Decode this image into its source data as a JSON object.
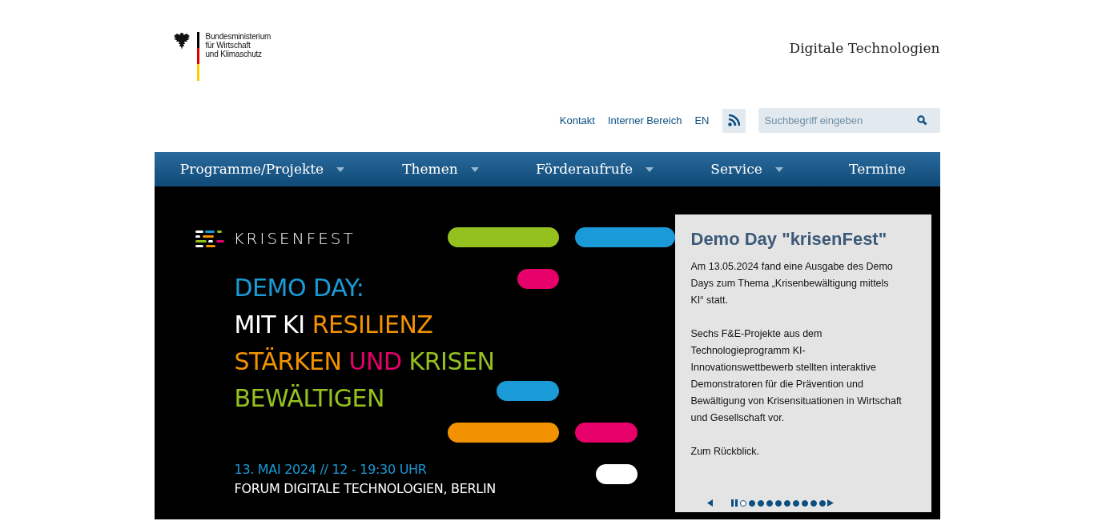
{
  "header": {
    "ministry_lines": [
      "Bundesministerium",
      "für Wirtschaft",
      "und Klimaschutz"
    ],
    "site_title": "Digitale Technologien"
  },
  "utility_links": [
    "Kontakt",
    "Interner Bereich",
    "EN"
  ],
  "search": {
    "placeholder": "Suchbegriff eingeben"
  },
  "nav": [
    {
      "label": "Programme/Projekte",
      "has_menu": true
    },
    {
      "label": "Themen",
      "has_menu": true
    },
    {
      "label": "Förderaufrufe",
      "has_menu": true
    },
    {
      "label": "Service",
      "has_menu": true
    },
    {
      "label": "Termine",
      "has_menu": false
    }
  ],
  "banner": {
    "brand": "KRISENFEST",
    "headline_lines": [
      [
        {
          "text": "DEMO DAY:",
          "color": "#1a9ad6"
        }
      ],
      [
        {
          "text": "MIT KI",
          "color": "#ffffff"
        },
        {
          "text": "RESILIENZ",
          "color": "#f39200"
        }
      ],
      [
        {
          "text": "STÄRKEN",
          "color": "#f39200"
        },
        {
          "text": "UND",
          "color": "#e5006a"
        },
        {
          "text": "KRISEN",
          "color": "#95c11f"
        }
      ],
      [
        {
          "text": "BEWÄLTIGEN",
          "color": "#95c11f"
        }
      ]
    ],
    "date": "13. MAI 2024 // 12 - 19:30 UHR",
    "venue": "FORUM DIGITALE TECHNOLOGIEN, BERLIN"
  },
  "teaser": {
    "title": "Demo Day \"krisenFest\"",
    "paragraphs": [
      "Am 13.05.2024 fand eine Ausgabe des Demo Days zum Thema „Krisenbewältigung mittels KI“ statt.",
      "Sechs F&E-Projekte aus dem Technologieprogramm KI-Innovationswettbewerb stellten interaktive Demonstratoren für die Prävention und Bewältigung von Krisensituationen in Wirtschaft und Gesellschaft vor.",
      "Zum Rückblick."
    ]
  },
  "slider": {
    "dots": [
      {
        "selected": true
      },
      {
        "selected": false
      },
      {
        "selected": false
      },
      {
        "selected": false
      },
      {
        "selected": false
      },
      {
        "selected": false
      },
      {
        "selected": false
      },
      {
        "selected": false
      },
      {
        "selected": false
      },
      {
        "selected": false
      }
    ]
  }
}
